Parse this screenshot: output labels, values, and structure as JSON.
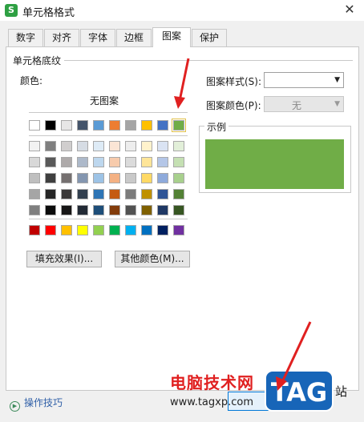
{
  "window": {
    "title": "单元格格式",
    "app_icon_glyph": "S",
    "close_glyph": "✕"
  },
  "tabs": [
    {
      "label": "数字",
      "active": false
    },
    {
      "label": "对齐",
      "active": false
    },
    {
      "label": "字体",
      "active": false
    },
    {
      "label": "边框",
      "active": false
    },
    {
      "label": "图案",
      "active": true
    },
    {
      "label": "保护",
      "active": false
    }
  ],
  "shading": {
    "group_title": "单元格底纹",
    "color_label": "颜色:",
    "no_pattern": "无图案",
    "theme_top_row": [
      "#ffffff",
      "#000000",
      "#e7e6e6",
      "#44546a",
      "#5b9bd5",
      "#ed7d31",
      "#a5a5a5",
      "#ffc000",
      "#4472c4",
      "#70ad47"
    ],
    "shade_rows": [
      [
        "#f2f2f2",
        "#7f7f7f",
        "#d0cece",
        "#d6dce4",
        "#deebf6",
        "#fbe5d5",
        "#ededed",
        "#fff2cc",
        "#dae3f3",
        "#e2efd9"
      ],
      [
        "#d8d8d8",
        "#595959",
        "#aeaaaa",
        "#adb9ca",
        "#bdd7ee",
        "#f7cbac",
        "#dbdbdb",
        "#fee599",
        "#b4c6e7",
        "#c5e0b3"
      ],
      [
        "#bfbfbf",
        "#3f3f3f",
        "#757070",
        "#8496b0",
        "#9dc3e6",
        "#f4b183",
        "#c9c9c9",
        "#ffd965",
        "#8eaadb",
        "#a8d08d"
      ],
      [
        "#a5a5a5",
        "#262626",
        "#3a3838",
        "#323f4f",
        "#2e75b5",
        "#c55a11",
        "#7b7b7b",
        "#bf9000",
        "#2f5496",
        "#538135"
      ],
      [
        "#7f7f7f",
        "#0c0c0c",
        "#171616",
        "#222a35",
        "#1e4e79",
        "#833c0b",
        "#525252",
        "#7f6000",
        "#1f3864",
        "#375623"
      ]
    ],
    "standard_row": [
      "#c00000",
      "#ff0000",
      "#ffc000",
      "#ffff00",
      "#92d050",
      "#00b050",
      "#00b0f0",
      "#0070c0",
      "#002060",
      "#7030a0"
    ],
    "selected_color": "#70ad47",
    "fill_effects_button": "填充效果(I)...",
    "more_colors_button": "其他颜色(M)..."
  },
  "pattern": {
    "style_label": "图案样式(S):",
    "style_value": "",
    "color_label": "图案颜色(P):",
    "color_value": "无"
  },
  "sample": {
    "label": "示例",
    "fill_color": "#70ad47"
  },
  "footer": {
    "help_label": "操作技巧"
  },
  "watermark": {
    "brand_text": "电脑技术网",
    "url": "www.tagxp.com",
    "logo_text": "TAG",
    "site_char": "站"
  },
  "annotations": {
    "arrow_color": "#e02020"
  }
}
